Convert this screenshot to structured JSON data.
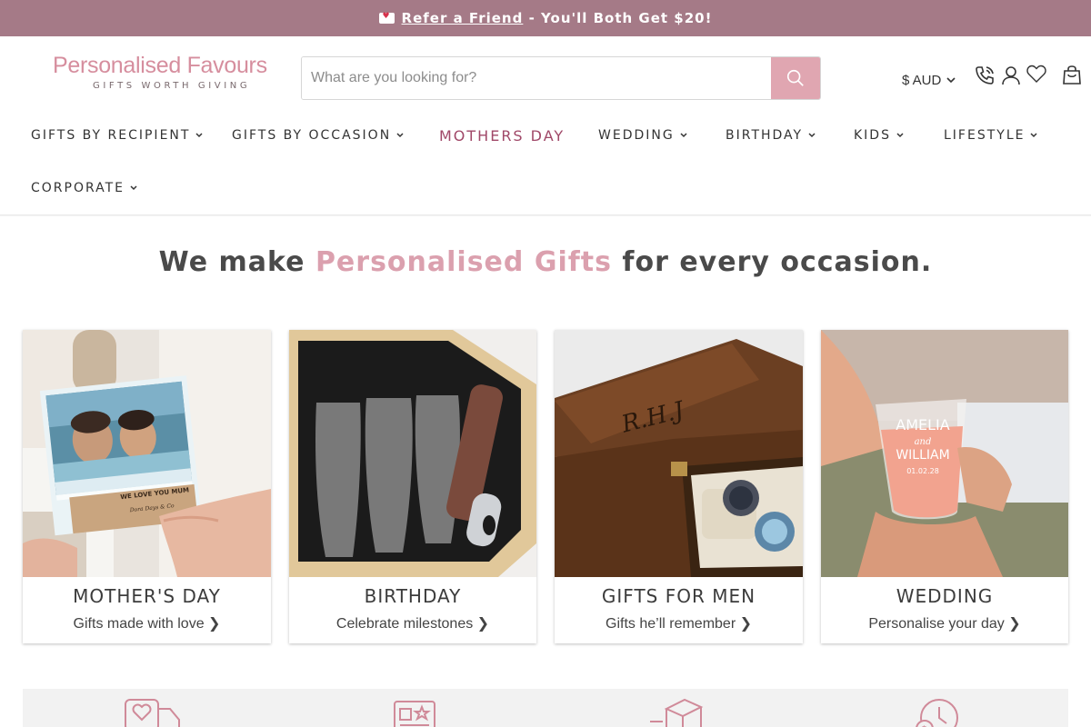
{
  "announcement": {
    "icon": "love-letter-icon",
    "link_text": "Refer a Friend",
    "rest_text": " - You'll Both Get $20!"
  },
  "brand": {
    "name": "Personalised Favours",
    "tagline": "GIFTS WORTH GIVING",
    "color": "#d68e9e"
  },
  "search": {
    "placeholder": "What are you looking for?",
    "value": ""
  },
  "header": {
    "currency": "$ AUD",
    "icons": [
      "phone-icon",
      "user-icon",
      "heart-icon",
      "cart-icon"
    ]
  },
  "nav": {
    "items": [
      {
        "label": "GIFTS BY RECIPIENT"
      },
      {
        "label": "GIFTS BY OCCASION"
      },
      {
        "label": "MOTHERS DAY"
      },
      {
        "label": "WEDDING"
      },
      {
        "label": "BIRTHDAY"
      },
      {
        "label": "KIDS"
      },
      {
        "label": "LIFESTYLE"
      },
      {
        "label": "CORPORATE"
      }
    ]
  },
  "hero": {
    "prefix": "We make ",
    "accent": "Personalised Gifts",
    "suffix": " for every occasion."
  },
  "cards": [
    {
      "title": "MOTHER'S DAY",
      "subtitle": "Gifts made with love ❯",
      "image_text": [
        "WE LOVE YOU MUM",
        "Dora Days & Co"
      ]
    },
    {
      "title": "BIRTHDAY",
      "subtitle": "Celebrate milestones ❯"
    },
    {
      "title": "GIFTS FOR MEN",
      "subtitle": "Gifts he’ll remember ❯",
      "image_text": [
        "R.H.J"
      ]
    },
    {
      "title": "WEDDING",
      "subtitle": "Personalise your day ❯",
      "image_text": [
        "AMELIA",
        "and",
        "WILLIAM",
        "01.02.28"
      ]
    }
  ],
  "benefits": {
    "icons": [
      "delivery-truck-heart-icon",
      "review-card-icon",
      "package-icon",
      "clock-money-icon"
    ]
  },
  "colors": {
    "announcement_bg": "#a57a87",
    "accent_pink": "#dba0ae",
    "nav_highlight": "#a04868",
    "search_button": "#e0a6b1"
  }
}
